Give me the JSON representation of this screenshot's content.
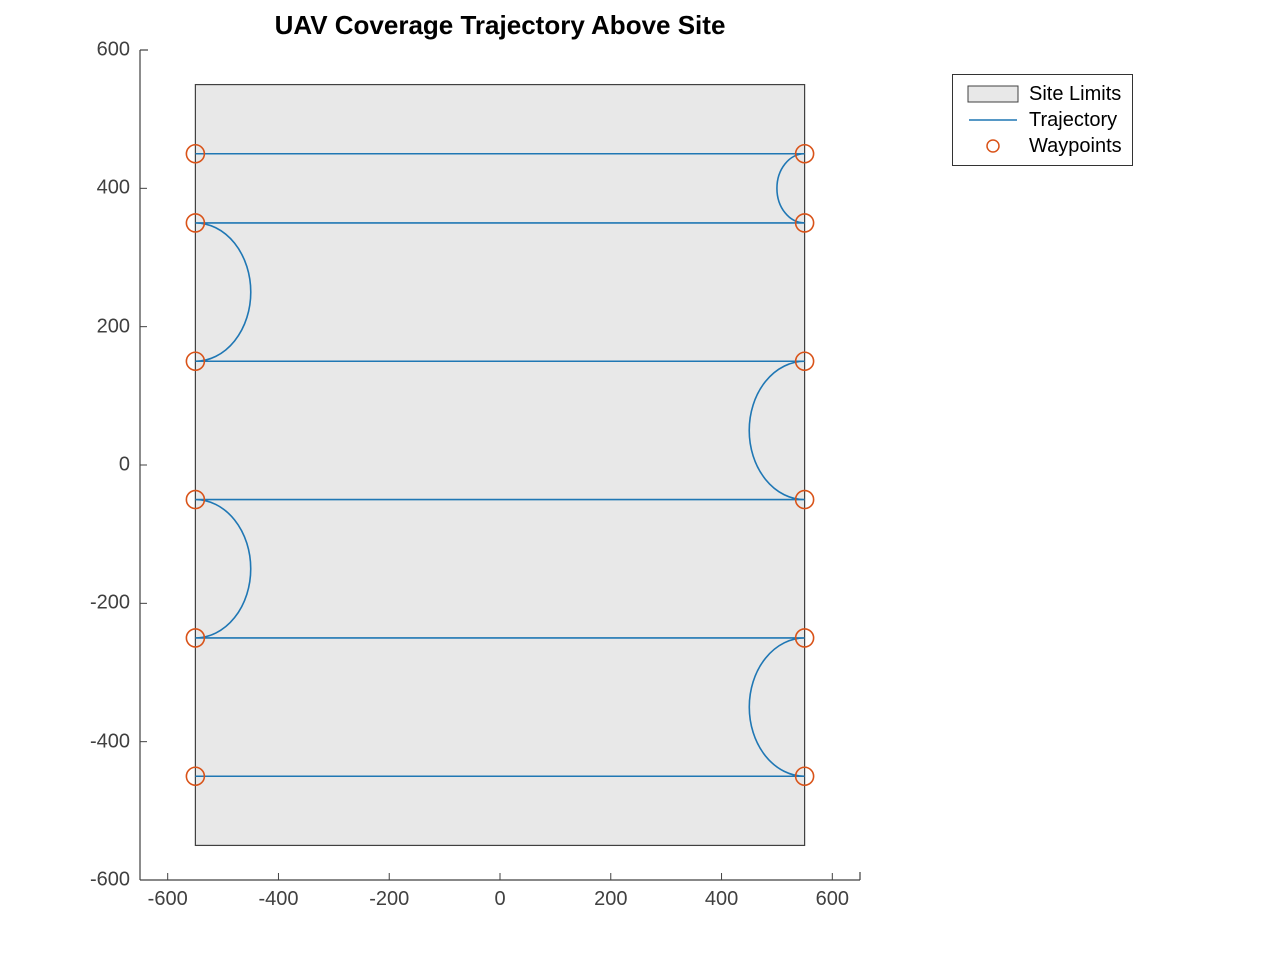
{
  "title": "UAV Coverage Trajectory Above Site",
  "legend": {
    "site": "Site Limits",
    "trajectory": "Trajectory",
    "waypoints": "Waypoints"
  },
  "axes": {
    "x_ticks": [
      -600,
      -400,
      -200,
      0,
      200,
      400,
      600
    ],
    "y_ticks": [
      -600,
      -400,
      -200,
      0,
      200,
      400,
      600
    ],
    "xlim": [
      -650,
      650
    ],
    "ylim": [
      -600,
      600
    ]
  },
  "colors": {
    "site_fill": "#e8e8e8",
    "site_stroke": "#404040",
    "trajectory": "#1f77b4",
    "waypoint_stroke": "#d95319",
    "axis": "#404040"
  },
  "chart_data": {
    "type": "line",
    "title": "UAV Coverage Trajectory Above Site",
    "xlabel": "",
    "ylabel": "",
    "xlim": [
      -650,
      650
    ],
    "ylim": [
      -600,
      600
    ],
    "site_limits": {
      "x": [
        -550,
        550
      ],
      "y": [
        -550,
        550
      ]
    },
    "series": [
      {
        "name": "Trajectory",
        "waypoints_x": [
          -550,
          550,
          550,
          -550,
          -550,
          550,
          550,
          -550,
          -550,
          550,
          550,
          -550
        ],
        "waypoints_y": [
          -450,
          -450,
          -250,
          -250,
          -50,
          -50,
          150,
          150,
          350,
          350,
          450,
          450
        ],
        "turn_arcs": [
          {
            "side": "right",
            "center": [
              550,
              -350
            ],
            "radius": 100,
            "from": [
              550,
              -450
            ],
            "to": [
              550,
              -250
            ]
          },
          {
            "side": "left",
            "center": [
              -550,
              -150
            ],
            "radius": 100,
            "from": [
              -550,
              -250
            ],
            "to": [
              -550,
              -50
            ]
          },
          {
            "side": "right",
            "center": [
              550,
              50
            ],
            "radius": 100,
            "from": [
              550,
              -50
            ],
            "to": [
              550,
              150
            ]
          },
          {
            "side": "left",
            "center": [
              -550,
              250
            ],
            "radius": 100,
            "from": [
              -550,
              150
            ],
            "to": [
              -550,
              350
            ]
          },
          {
            "side": "right",
            "center": [
              550,
              400
            ],
            "radius": 50,
            "from": [
              550,
              350
            ],
            "to": [
              550,
              450
            ]
          }
        ]
      },
      {
        "name": "Waypoints",
        "x": [
          -550,
          550,
          550,
          -550,
          -550,
          550,
          550,
          -550,
          -550,
          550,
          550,
          -550
        ],
        "y": [
          -450,
          -450,
          -250,
          -250,
          -50,
          -50,
          150,
          150,
          350,
          350,
          450,
          450
        ]
      }
    ]
  }
}
